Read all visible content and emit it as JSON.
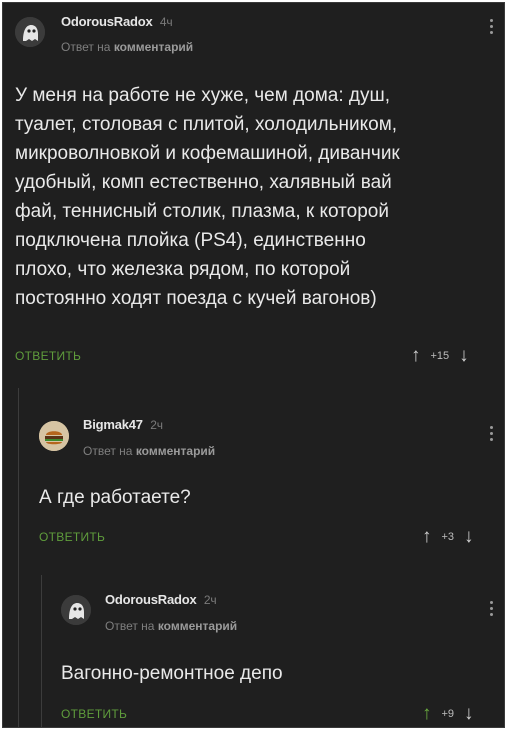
{
  "comments": [
    {
      "author": "OdorousRadox",
      "time": "4ч",
      "reply_prefix": "Ответ на",
      "reply_target": "комментарий",
      "text": "У меня на работе не хуже, чем дома: душ,\nтуалет, столовая с плитой, холодильником,\nмикроволновкой и кофемашиной, диванчик\nудобный, комп естественно, халявный вай\nфай, теннисный столик, плазма, к которой\nподключена плойка (PS4), единственно\nплохо, что железка рядом, по которой\nпостоянно ходят поезда с кучей вагонов)",
      "reply_label": "ответить",
      "score": "+15",
      "avatar_icon": "ghost-avatar-icon"
    },
    {
      "author": "Bigmak47",
      "time": "2ч",
      "reply_prefix": "Ответ на",
      "reply_target": "комментарий",
      "text": "А где работаете?",
      "reply_label": "ответить",
      "score": "+3",
      "avatar_icon": "burger-avatar-icon"
    },
    {
      "author": "OdorousRadox",
      "time": "2ч",
      "reply_prefix": "Ответ на",
      "reply_target": "комментарий",
      "text": "Вагонно-ремонтное депо",
      "reply_label": "ответить",
      "score": "+9",
      "avatar_icon": "ghost-avatar-icon"
    }
  ],
  "colors": {
    "background": "#1f1f1f",
    "reply_button": "#5f9d3c",
    "upvote_active": "#6aab3f"
  }
}
